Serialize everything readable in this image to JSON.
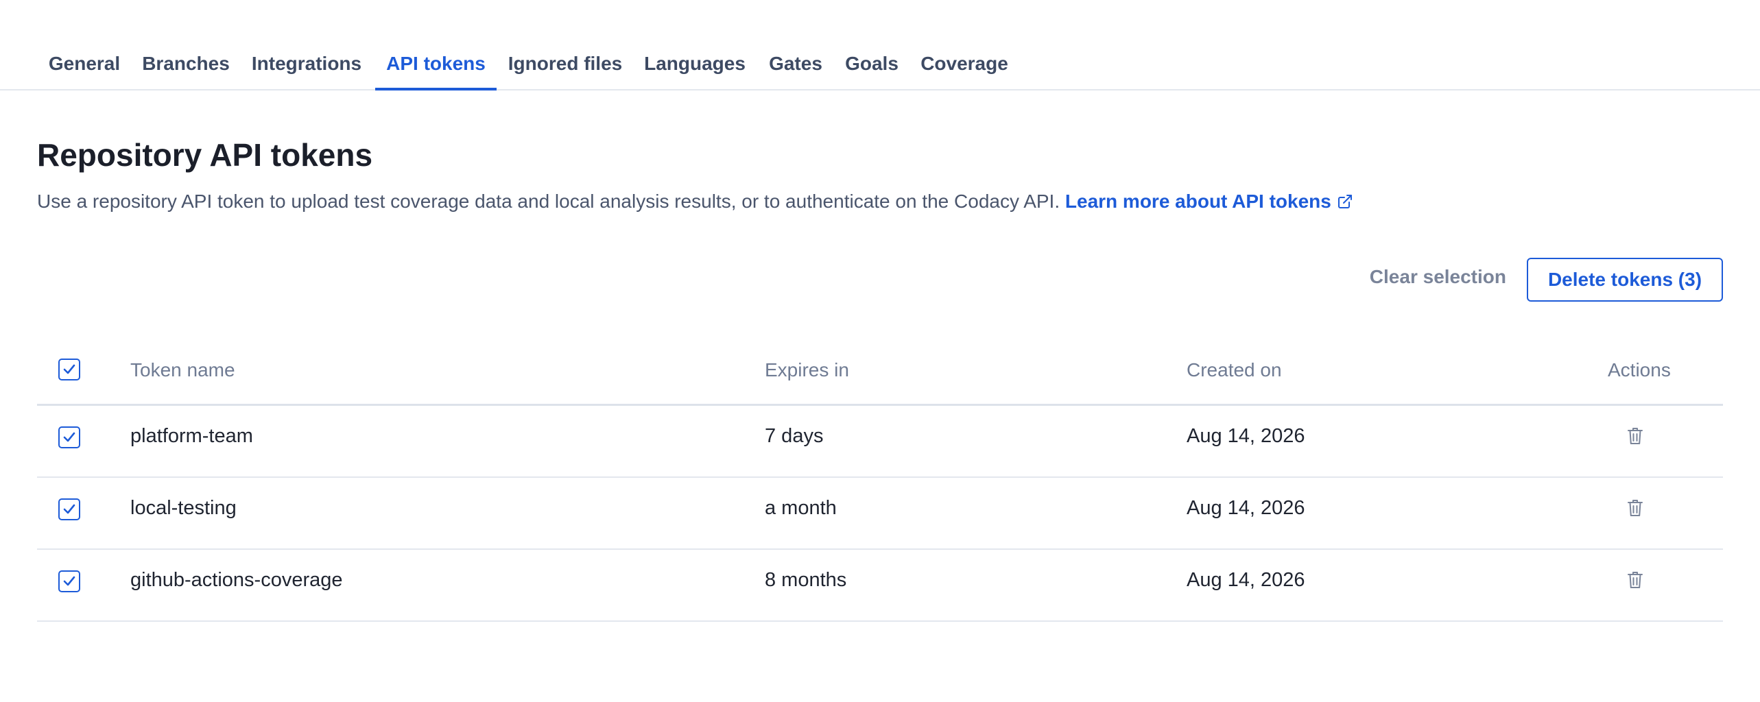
{
  "tabs": [
    {
      "label": "General"
    },
    {
      "label": "Branches"
    },
    {
      "label": "Integrations"
    },
    {
      "label": "API tokens",
      "active": true
    },
    {
      "label": "Ignored files"
    },
    {
      "label": "Languages"
    },
    {
      "label": "Gates"
    },
    {
      "label": "Goals"
    },
    {
      "label": "Coverage"
    }
  ],
  "page": {
    "title": "Repository API tokens",
    "description": "Use a repository API token to upload test coverage data and local analysis results, or to authenticate on the Codacy API.",
    "learn_more_link": "Learn more about API tokens",
    "learn_more_icon": "external-link-icon"
  },
  "actions": {
    "clear_selection": "Clear selection",
    "delete_tokens": "Delete tokens (3)"
  },
  "table": {
    "columns": {
      "name": "Token name",
      "expires": "Expires in",
      "created": "Created on",
      "actions": "Actions"
    },
    "all_selected": true,
    "rows": [
      {
        "name": "platform-team",
        "expires": "7 days",
        "created": "Aug 14, 2026",
        "selected": true
      },
      {
        "name": "local-testing",
        "expires": "a month",
        "created": "Aug 14, 2026",
        "selected": true
      },
      {
        "name": "github-actions-coverage",
        "expires": "8 months",
        "created": "Aug 14, 2026",
        "selected": true
      }
    ]
  },
  "colors": {
    "accent": "#1d5bd8",
    "text_muted": "#6f7b93",
    "border": "#e3e7ee"
  }
}
